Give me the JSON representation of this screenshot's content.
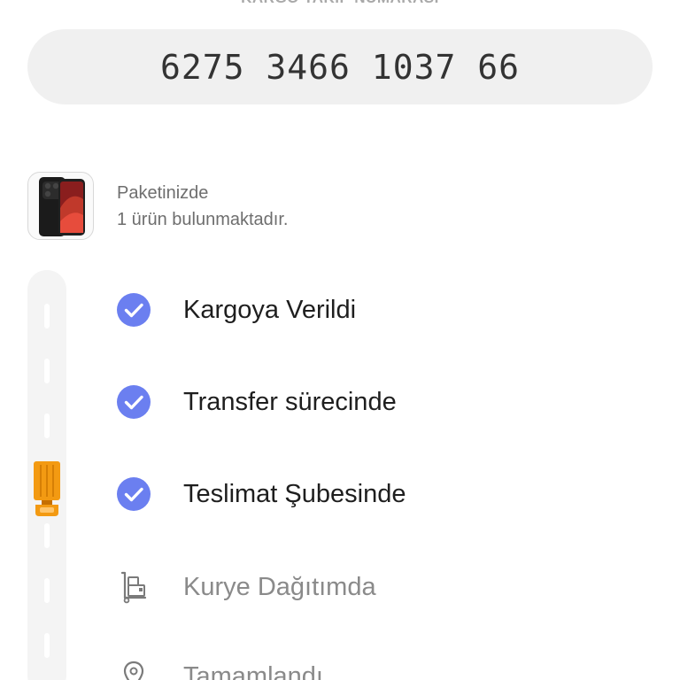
{
  "tracking": {
    "label": "KARGO TAKİP NUMARASI",
    "number": "6275 3466 1037 66"
  },
  "package": {
    "line1": "Paketinizde",
    "line2": "1 ürün bulunmaktadır."
  },
  "steps": [
    {
      "label": "Kargoya Verildi",
      "status": "completed",
      "icon": "check-circle-icon"
    },
    {
      "label": "Transfer sürecinde",
      "status": "completed",
      "icon": "check-circle-icon"
    },
    {
      "label": "Teslimat Şubesinde",
      "status": "completed",
      "icon": "check-circle-icon"
    },
    {
      "label": "Kurye Dağıtımda",
      "status": "pending",
      "icon": "courier-dolly-icon"
    },
    {
      "label": "Tamamlandı",
      "status": "pending",
      "icon": "location-pin-icon"
    }
  ],
  "colors": {
    "check": "#6b7ff0",
    "truck": "#f39a12",
    "pending_text": "#8a8a8a",
    "done_text": "#1e1e1e"
  }
}
